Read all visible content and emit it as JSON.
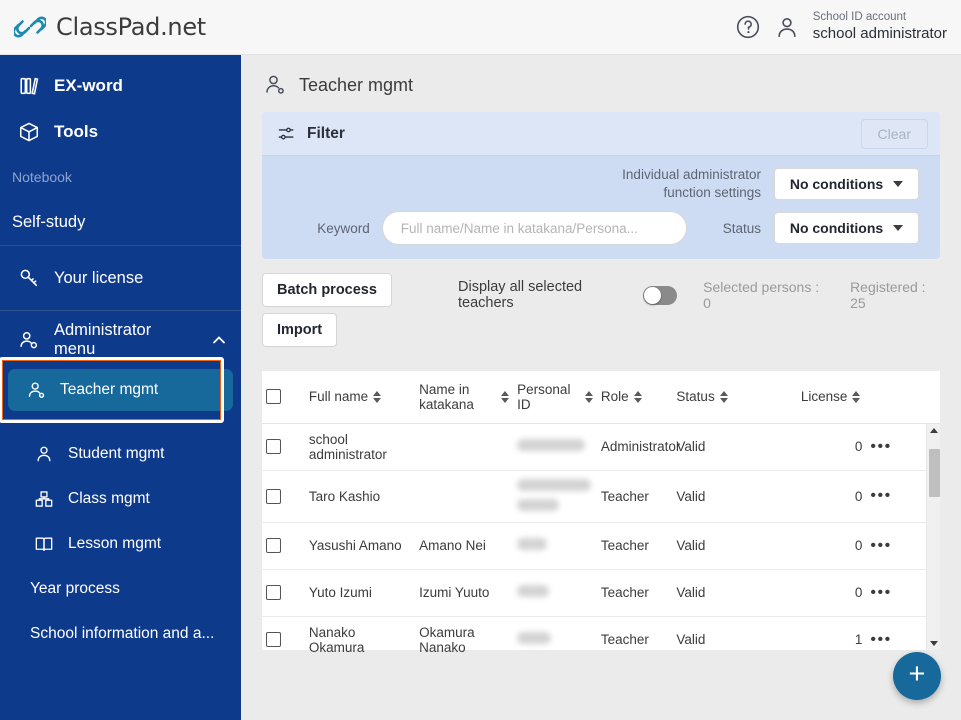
{
  "header": {
    "brand": "ClassPad.net",
    "logo_icon": "chain-link-icon",
    "help_icon": "help-circle-icon",
    "user_icon": "person-icon",
    "account_label": "School ID account",
    "account_name": "school administrator"
  },
  "sidebar": {
    "background_color": "#0e3a8c",
    "active_color": "#17699b",
    "annotation_color": "#ee6511",
    "items": [
      {
        "label": "EX-word",
        "icon": "books-icon",
        "style": "bold"
      },
      {
        "label": "Tools",
        "icon": "toolbox-icon",
        "style": "bold"
      },
      {
        "label": "Notebook",
        "icon": "none",
        "style": "dim"
      },
      {
        "label": "Self-study",
        "icon": "none",
        "style": "plain"
      },
      {
        "label": "Your license",
        "icon": "key-icon",
        "style": "plain"
      },
      {
        "label": "Administrator menu",
        "icon": "admin-person-icon",
        "style": "plain",
        "chevron": "chevron-up-icon"
      }
    ],
    "sub_items": [
      {
        "label": "Teacher mgmt",
        "icon": "teacher-icon",
        "active": true
      },
      {
        "label": "Student mgmt",
        "icon": "student-icon",
        "active": false
      },
      {
        "label": "Class mgmt",
        "icon": "class-icon",
        "active": false
      },
      {
        "label": "Lesson mgmt",
        "icon": "book-open-icon",
        "active": false
      },
      {
        "label": "Year process",
        "icon": "none",
        "active": false
      },
      {
        "label": "School information and a...",
        "icon": "none",
        "active": false
      }
    ]
  },
  "page": {
    "title": "Teacher mgmt",
    "title_icon": "teacher-icon"
  },
  "filter": {
    "title": "Filter",
    "icon": "sliders-icon",
    "clear_label": "Clear",
    "admin_function_label_line1": "Individual administrator",
    "admin_function_label_line2": "function settings",
    "admin_function_value": "No conditions",
    "keyword_label": "Keyword",
    "keyword_value": "",
    "keyword_placeholder": "Full name/Name in katakana/Persona...",
    "status_label": "Status",
    "status_value": "No conditions"
  },
  "toolbar": {
    "batch_process_label": "Batch process",
    "import_label": "Import",
    "display_all_label": "Display all selected teachers",
    "toggle_state": "off",
    "selected_persons": "Selected persons : 0",
    "registered": "Registered : 25"
  },
  "table": {
    "columns": [
      {
        "label": "",
        "sortable": false
      },
      {
        "label": "Full name",
        "sortable": true
      },
      {
        "label": "Name in katakana",
        "sortable": true
      },
      {
        "label": "Personal ID",
        "sortable": true
      },
      {
        "label": "Role",
        "sortable": true
      },
      {
        "label": "Status",
        "sortable": true
      },
      {
        "label": "License",
        "sortable": true
      },
      {
        "label": "",
        "sortable": false
      }
    ],
    "rows": [
      {
        "full_name": "school administrator",
        "katakana": "",
        "personal_id": "",
        "personal_id_redacted": true,
        "role": "Administrator",
        "status": "Valid",
        "license": "0",
        "menu": "more-options-icon"
      },
      {
        "full_name": "Taro Kashio",
        "katakana": "",
        "personal_id": "",
        "personal_id_redacted": true,
        "role": "Teacher",
        "status": "Valid",
        "license": "0",
        "menu": "more-options-icon"
      },
      {
        "full_name": "Yasushi Amano",
        "katakana": "Amano Nei",
        "personal_id": "",
        "personal_id_redacted": true,
        "role": "Teacher",
        "status": "Valid",
        "license": "0",
        "menu": "more-options-icon"
      },
      {
        "full_name": "Yuto Izumi",
        "katakana": "Izumi Yuuto",
        "personal_id": "",
        "personal_id_redacted": true,
        "role": "Teacher",
        "status": "Valid",
        "license": "0",
        "menu": "more-options-icon"
      },
      {
        "full_name": "Nanako Okamura",
        "katakana": "Okamura Nanako",
        "personal_id": "",
        "personal_id_redacted": true,
        "role": "Teacher",
        "status": "Valid",
        "license": "1",
        "menu": "more-options-icon"
      }
    ]
  },
  "fab": {
    "icon": "plus-icon",
    "label": "+"
  }
}
